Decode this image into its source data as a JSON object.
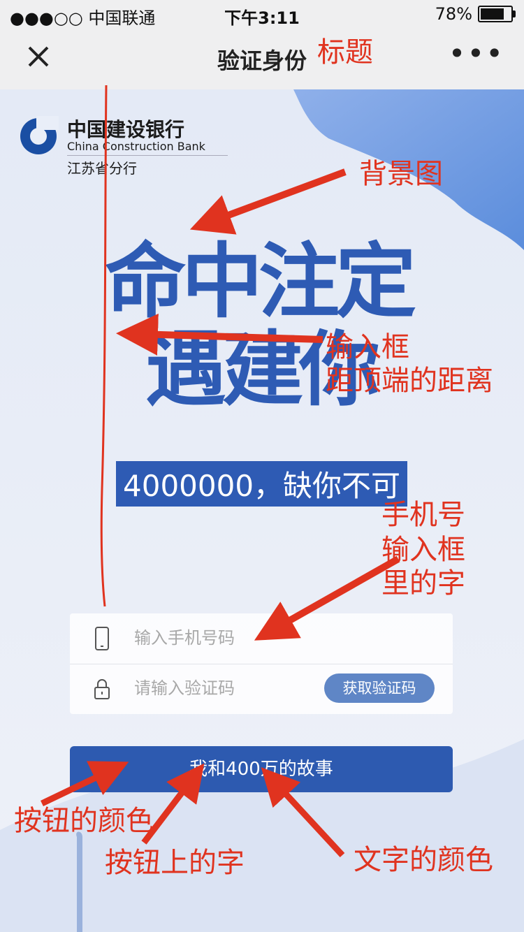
{
  "status_bar": {
    "carrier": "●●●○○ 中国联通",
    "time": "下午3:11",
    "battery": "78%",
    "battery_level": 0.78
  },
  "navbar": {
    "title": "验证身份",
    "close_icon": "close-icon",
    "more_icon": "more-icon"
  },
  "bank": {
    "name_cn": "中国建设银行",
    "name_en": "China Construction Bank",
    "branch": "江苏省分行"
  },
  "headline": {
    "line1": "命中注定",
    "line2": "遇建你",
    "tagline": "4000000，缺你不可"
  },
  "form": {
    "phone_placeholder": "输入手机号码",
    "code_placeholder": "请输入验证码",
    "get_code_label": "获取验证码"
  },
  "submit_label": "我和400万的故事",
  "colors": {
    "accent": "#2d5ab0",
    "annotation": "#e0331f"
  },
  "annotations": {
    "title": "标题",
    "background": "背景图",
    "input_offset_1": "输入框",
    "input_offset_2": "距顶端的距离",
    "phone_text_1": "手机号",
    "phone_text_2": "输入框",
    "phone_text_3": "里的字",
    "button_color": "按钮的颜色",
    "button_text": "按钮上的字",
    "text_color": "文字的颜色"
  }
}
